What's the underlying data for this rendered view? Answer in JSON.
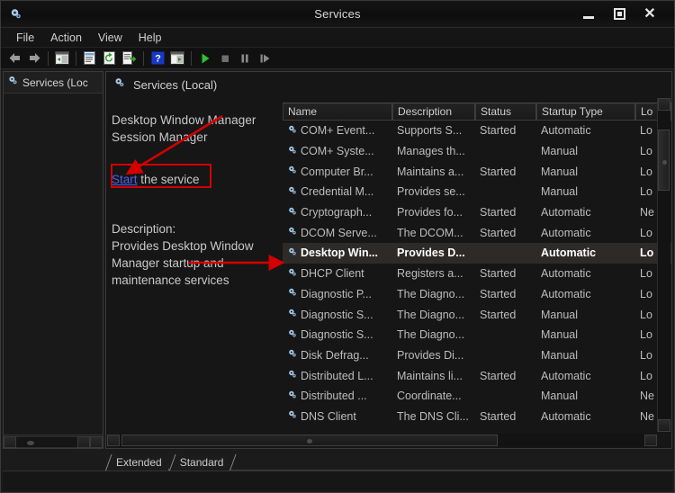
{
  "window": {
    "title": "Services",
    "icon": "services-gear-icon",
    "buttons": {
      "minimize": "minimize",
      "maximize": "maximize",
      "close": "close"
    }
  },
  "menubar": {
    "items": [
      "File",
      "Action",
      "View",
      "Help"
    ]
  },
  "toolbar": {
    "buttons": [
      {
        "name": "back-icon",
        "glyph": "back"
      },
      {
        "name": "forward-icon",
        "glyph": "forward"
      },
      {
        "name": "show-hide-console-tree-icon",
        "glyph": "tree"
      },
      {
        "name": "properties-icon",
        "glyph": "properties"
      },
      {
        "name": "refresh-icon",
        "glyph": "refresh"
      },
      {
        "name": "export-list-icon",
        "glyph": "export"
      },
      {
        "name": "help-icon",
        "glyph": "help"
      },
      {
        "name": "show-hide-action-pane-icon",
        "glyph": "pane"
      },
      {
        "name": "start-service-icon",
        "glyph": "play"
      },
      {
        "name": "stop-service-icon",
        "glyph": "stop"
      },
      {
        "name": "pause-service-icon",
        "glyph": "pause"
      },
      {
        "name": "restart-service-icon",
        "glyph": "restart"
      }
    ]
  },
  "left_pane": {
    "tree_root_label": "Services (Loc",
    "icon": "services-gear-icon"
  },
  "right_pane": {
    "header_label": "Services (Local)",
    "header_icon": "services-gear-icon",
    "detail": {
      "service_name": "Desktop Window Manager Session Manager",
      "action_link": "Start",
      "action_suffix": " the service",
      "description_label": "Description:",
      "description_text": "Provides Desktop Window Manager startup and maintenance services"
    },
    "columns": [
      "Name",
      "Description",
      "Status",
      "Startup Type",
      "Lo"
    ],
    "rows": [
      {
        "name": "COM+ Event...",
        "description": "Supports S...",
        "status": "Started",
        "startup": "Automatic",
        "logon": "Lo",
        "selected": false
      },
      {
        "name": "COM+ Syste...",
        "description": "Manages th...",
        "status": "",
        "startup": "Manual",
        "logon": "Lo",
        "selected": false
      },
      {
        "name": "Computer Br...",
        "description": "Maintains a...",
        "status": "Started",
        "startup": "Manual",
        "logon": "Lo",
        "selected": false
      },
      {
        "name": "Credential M...",
        "description": "Provides se...",
        "status": "",
        "startup": "Manual",
        "logon": "Lo",
        "selected": false
      },
      {
        "name": "Cryptograph...",
        "description": "Provides fo...",
        "status": "Started",
        "startup": "Automatic",
        "logon": "Ne",
        "selected": false
      },
      {
        "name": "DCOM Serve...",
        "description": "The DCOM...",
        "status": "Started",
        "startup": "Automatic",
        "logon": "Lo",
        "selected": false
      },
      {
        "name": "Desktop Win...",
        "description": "Provides D...",
        "status": "",
        "startup": "Automatic",
        "logon": "Lo",
        "selected": true
      },
      {
        "name": "DHCP Client",
        "description": "Registers a...",
        "status": "Started",
        "startup": "Automatic",
        "logon": "Lo",
        "selected": false
      },
      {
        "name": "Diagnostic P...",
        "description": "The Diagno...",
        "status": "Started",
        "startup": "Automatic",
        "logon": "Lo",
        "selected": false
      },
      {
        "name": "Diagnostic S...",
        "description": "The Diagno...",
        "status": "Started",
        "startup": "Manual",
        "logon": "Lo",
        "selected": false
      },
      {
        "name": "Diagnostic S...",
        "description": "The Diagno...",
        "status": "",
        "startup": "Manual",
        "logon": "Lo",
        "selected": false
      },
      {
        "name": "Disk Defrag...",
        "description": "Provides Di...",
        "status": "",
        "startup": "Manual",
        "logon": "Lo",
        "selected": false
      },
      {
        "name": "Distributed L...",
        "description": "Maintains li...",
        "status": "Started",
        "startup": "Automatic",
        "logon": "Lo",
        "selected": false
      },
      {
        "name": "Distributed ...",
        "description": "Coordinate...",
        "status": "",
        "startup": "Manual",
        "logon": "Ne",
        "selected": false
      },
      {
        "name": "DNS Client",
        "description": "The DNS Cli...",
        "status": "Started",
        "startup": "Automatic",
        "logon": "Ne",
        "selected": false
      }
    ]
  },
  "tabs": [
    {
      "label": "Extended",
      "active": false
    },
    {
      "label": "Standard",
      "active": true
    }
  ],
  "annotations": {
    "highlight_color": "#d40000",
    "arrow_to_start_link": "arrow pointing to Start link",
    "arrow_to_selected_row": "arrow pointing to Desktop Window Manager row",
    "box_around_start_line": "red rectangle around Start the service"
  },
  "colors": {
    "accent_link": "#4a62f5",
    "annotation_red": "#d40000",
    "selected_row_bg": "#2e2a28",
    "window_bg": "#1b1b1b"
  }
}
